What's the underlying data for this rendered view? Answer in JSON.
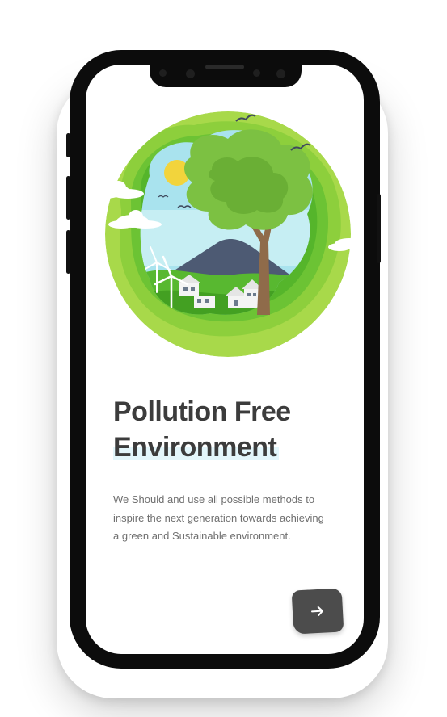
{
  "onboarding": {
    "title_line1": "Pollution Free",
    "title_line2": "Environment",
    "description": "We Should and use all possible methods to inspire the next generation towards achieving a green and Sustainable environment."
  },
  "icons": {
    "next": "arrow-right-icon"
  },
  "colors": {
    "phone_frame": "#0c0c0c",
    "screen_bg": "#ffffff",
    "title_text": "#3c3c3c",
    "body_text": "#6f6f6f",
    "button_bg": "#4c4c4c",
    "title_highlight": "#e3f6fb",
    "green_light": "#a8d94a",
    "green_mid": "#6cc334",
    "green_dark": "#49a623",
    "sky": "#a9e3ee",
    "sun": "#f2d43c"
  }
}
